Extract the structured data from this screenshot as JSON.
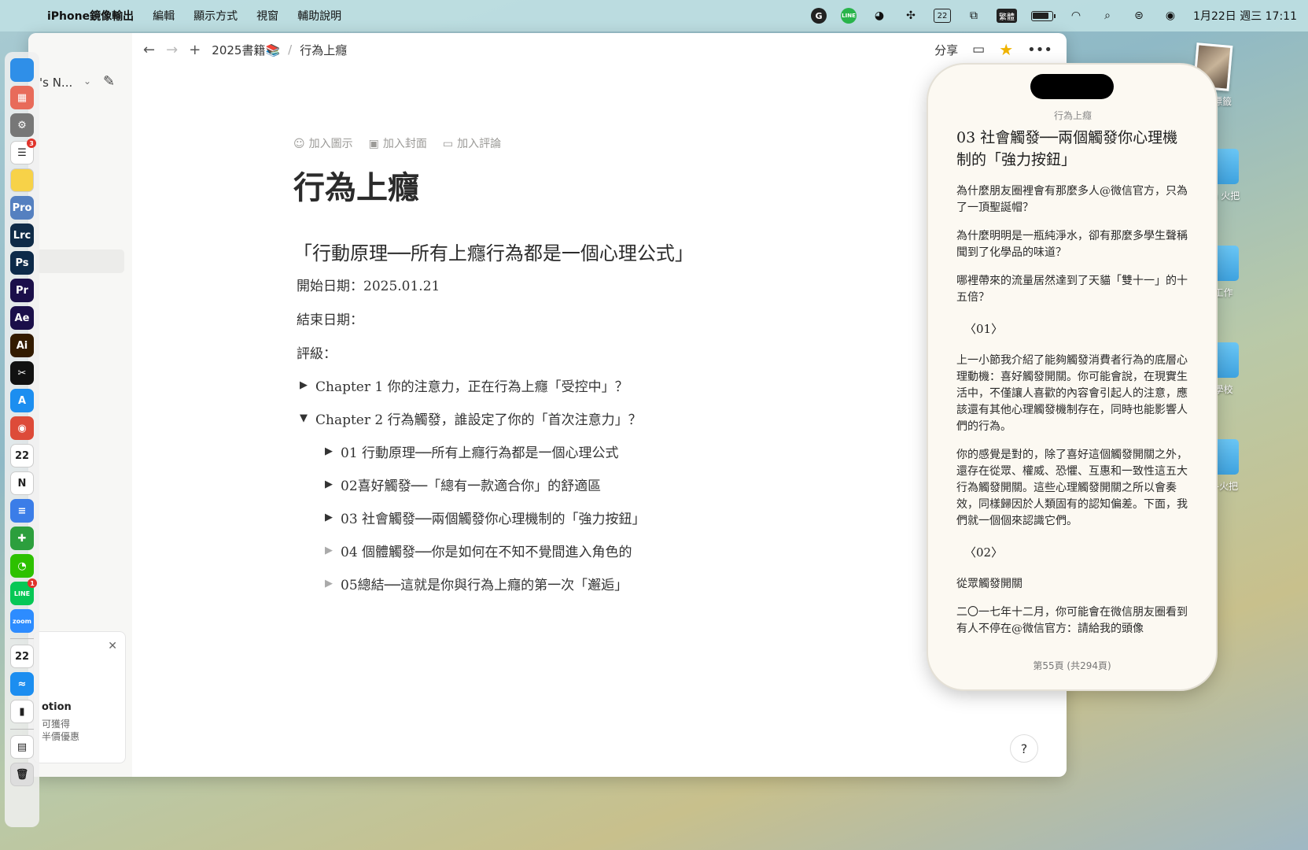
{
  "menubar": {
    "app_name": "iPhone鏡像輸出",
    "menus": [
      "編輯",
      "顯示方式",
      "視窗",
      "輔助說明"
    ],
    "tray": {
      "grammarly": "G",
      "line": "LINE",
      "calendar_day": "22",
      "input_method": "繁體"
    },
    "clock": "1月22日 週三 17:11"
  },
  "dock": {
    "icons": [
      {
        "name": "finder-icon",
        "label": "",
        "color": "#2f8fe8"
      },
      {
        "name": "launchpad-icon",
        "label": "▦",
        "color": "#e86b5a"
      },
      {
        "name": "system-settings-icon",
        "label": "⚙",
        "color": "#777"
      },
      {
        "name": "reminders-icon",
        "label": "☰",
        "color": "#ffffff",
        "badge": "3"
      },
      {
        "name": "notes-icon",
        "label": "",
        "color": "#f7d248"
      },
      {
        "name": "pro-app-icon",
        "label": "Pro",
        "color": "#5580c0"
      },
      {
        "name": "lightroom-classic-icon",
        "label": "Lrc",
        "color": "#0f2b48"
      },
      {
        "name": "photoshop-icon",
        "label": "Ps",
        "color": "#0d2a4a"
      },
      {
        "name": "premiere-icon",
        "label": "Pr",
        "color": "#1b0f4a"
      },
      {
        "name": "after-effects-icon",
        "label": "Ae",
        "color": "#1b0f4a"
      },
      {
        "name": "illustrator-icon",
        "label": "Ai",
        "color": "#331b00"
      },
      {
        "name": "capcut-icon",
        "label": "✂",
        "color": "#111"
      },
      {
        "name": "app-store-icon",
        "label": "A",
        "color": "#1c8ef0"
      },
      {
        "name": "chrome-icon",
        "label": "◉",
        "color": "#dd4b39"
      },
      {
        "name": "calendar-icon",
        "label": "22",
        "color": "#ffffff"
      },
      {
        "name": "notion-icon",
        "label": "N",
        "color": "#ffffff"
      },
      {
        "name": "docs-icon",
        "label": "≡",
        "color": "#3b7de8"
      },
      {
        "name": "numbers-icon",
        "label": "✚",
        "color": "#2c9f3d"
      },
      {
        "name": "wechat-icon",
        "label": "◔",
        "color": "#2dc100"
      },
      {
        "name": "line-app-icon",
        "label": "LINE",
        "color": "#06c755",
        "badge": "1"
      },
      {
        "name": "zoom-icon",
        "label": "zoom",
        "color": "#2d8cff"
      },
      {
        "name": "fantastical-icon",
        "label": "22",
        "color": "#ffffff"
      },
      {
        "name": "messenger-icon",
        "label": "≈",
        "color": "#1c8ef0"
      },
      {
        "name": "iphone-mirroring-icon",
        "label": "▮",
        "color": "#ffffff"
      },
      {
        "name": "preview-icon",
        "label": "▤",
        "color": "#ffffff"
      },
      {
        "name": "trash-icon",
        "label": "🗑",
        "color": "#dddddd"
      }
    ]
  },
  "notion": {
    "sidebar": {
      "workspace": "'s N...",
      "promo": {
        "title": "otion",
        "line1": "可獲得",
        "line2": "半價優惠"
      }
    },
    "topbar": {
      "breadcrumb_parent": "2025書籍📚",
      "breadcrumb_current": "行為上癮",
      "share": "分享"
    },
    "page": {
      "add_icon": "加入圖示",
      "add_cover": "加入封面",
      "add_comment": "加入評論",
      "title": "行為上癮",
      "heading": "「行動原理──所有上癮行為都是一個心理公式」",
      "start_date": "開始日期：2025.01.21",
      "end_date": "結束日期：",
      "rating": "評級：",
      "chapters": [
        {
          "label": "Chapter 1 你的注意力，正在行為上癮「受控中」？",
          "expanded": false
        },
        {
          "label": "Chapter 2 行為觸發，誰設定了你的「首次注意力」？",
          "expanded": true
        }
      ],
      "subchapters": [
        "01 行動原理──所有上癮行為都是一個心理公式",
        "02喜好觸發──「總有一款適合你」的舒適區",
        "03 社會觸發──兩個觸發你心理機制的「強力按鈕」",
        "04 個體觸發──你是如何在不知不覺間進入角色的",
        "05總結──這就是你與行為上癮的第一次「邂逅」"
      ]
    }
  },
  "iphone": {
    "book_title": "行為上癮",
    "chapter_title": "03 社會觸發──兩個觸發你心理機制的「強力按鈕」",
    "paragraphs": [
      "為什麼朋友圈裡會有那麼多人@微信官方，只為了一頂聖誕帽？",
      "為什麼明明是一瓶純淨水，卻有那麼多學生聲稱聞到了化學品的味道？",
      "哪裡帶來的流量居然達到了天貓「雙十一」的十五倍？"
    ],
    "section1": "〈01〉",
    "para_s1a": "上一小節我介紹了能夠觸發消費者行為的底層心理動機：喜好觸發開關。你可能會說，在現實生活中，不僅讓人喜歡的內容會引起人的注意，應該還有其他心理觸發機制存在，同時也能影響人們的行為。",
    "para_s1b": "你的感覺是對的，除了喜好這個觸發開關之外，還存在從眾、權威、恐懼、互惠和一致性這五大行為觸發開關。這些心理觸發開關之所以會奏效，同樣歸因於人類固有的認知偏差。下面，我們就一個個來認識它們。",
    "section2": "〈02〉",
    "para_s2a": "從眾觸發開關",
    "para_s2b": "二〇一七年十二月，你可能會在微信朋友圈看到有人不停在@微信官方：請給我的頭像",
    "page_number": "第55頁 (共294頁)"
  },
  "desktop": {
    "photo_label": "沒有標籤",
    "folders": [
      "church 火把",
      "002-工作",
      "001-學校",
      "003-火把"
    ]
  }
}
